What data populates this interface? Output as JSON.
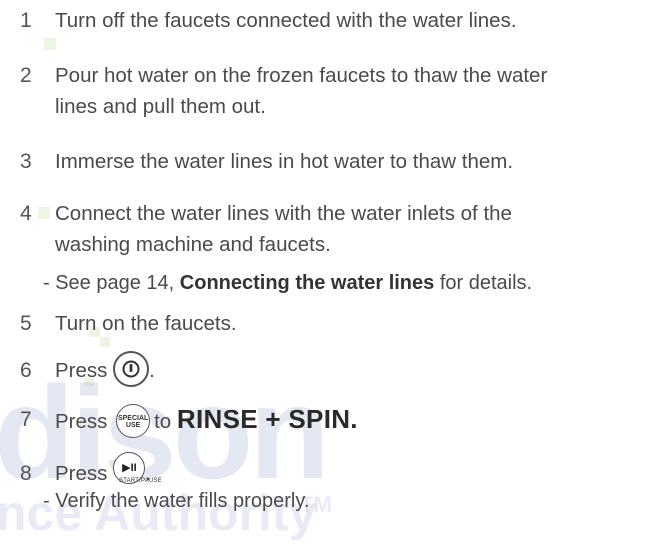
{
  "steps": [
    {
      "number": "1",
      "text": "Turn off the faucets connected with the water lines."
    },
    {
      "number": "2",
      "line1": "Pour hot water on the frozen faucets to thaw the water",
      "line2": "lines and pull them out."
    },
    {
      "number": "3",
      "text": "Immerse the water lines in hot water to thaw them."
    },
    {
      "number": "4",
      "line1": "Connect the water lines with the water inlets of the",
      "line2": "washing machine and faucets.",
      "note_prefix": "- See page 14, ",
      "note_bold": "Connecting the water lines",
      "note_suffix": " for details."
    },
    {
      "number": "5",
      "text": "Turn on the faucets."
    },
    {
      "number": "6",
      "text": "Press",
      "after": "."
    },
    {
      "number": "7",
      "text": "Press",
      "mid": "to",
      "bold": "RINSE + SPIN."
    },
    {
      "number": "8",
      "text": "Press",
      "after": ".",
      "note": "- Verify the water fills properly."
    }
  ],
  "buttons": {
    "power_icon": "power-icon",
    "special_use_line1": "SPECIAL",
    "special_use_line2": "USE",
    "start_pause_glyph": "▶II",
    "start_pause_caption": "START/PAUSE"
  },
  "watermark": {
    "line1": "dison",
    "line2": "nce Authority",
    "mark": "TM",
    "colors": {
      "blue": "#1f3f9f",
      "green": "#7dbd3a"
    }
  }
}
